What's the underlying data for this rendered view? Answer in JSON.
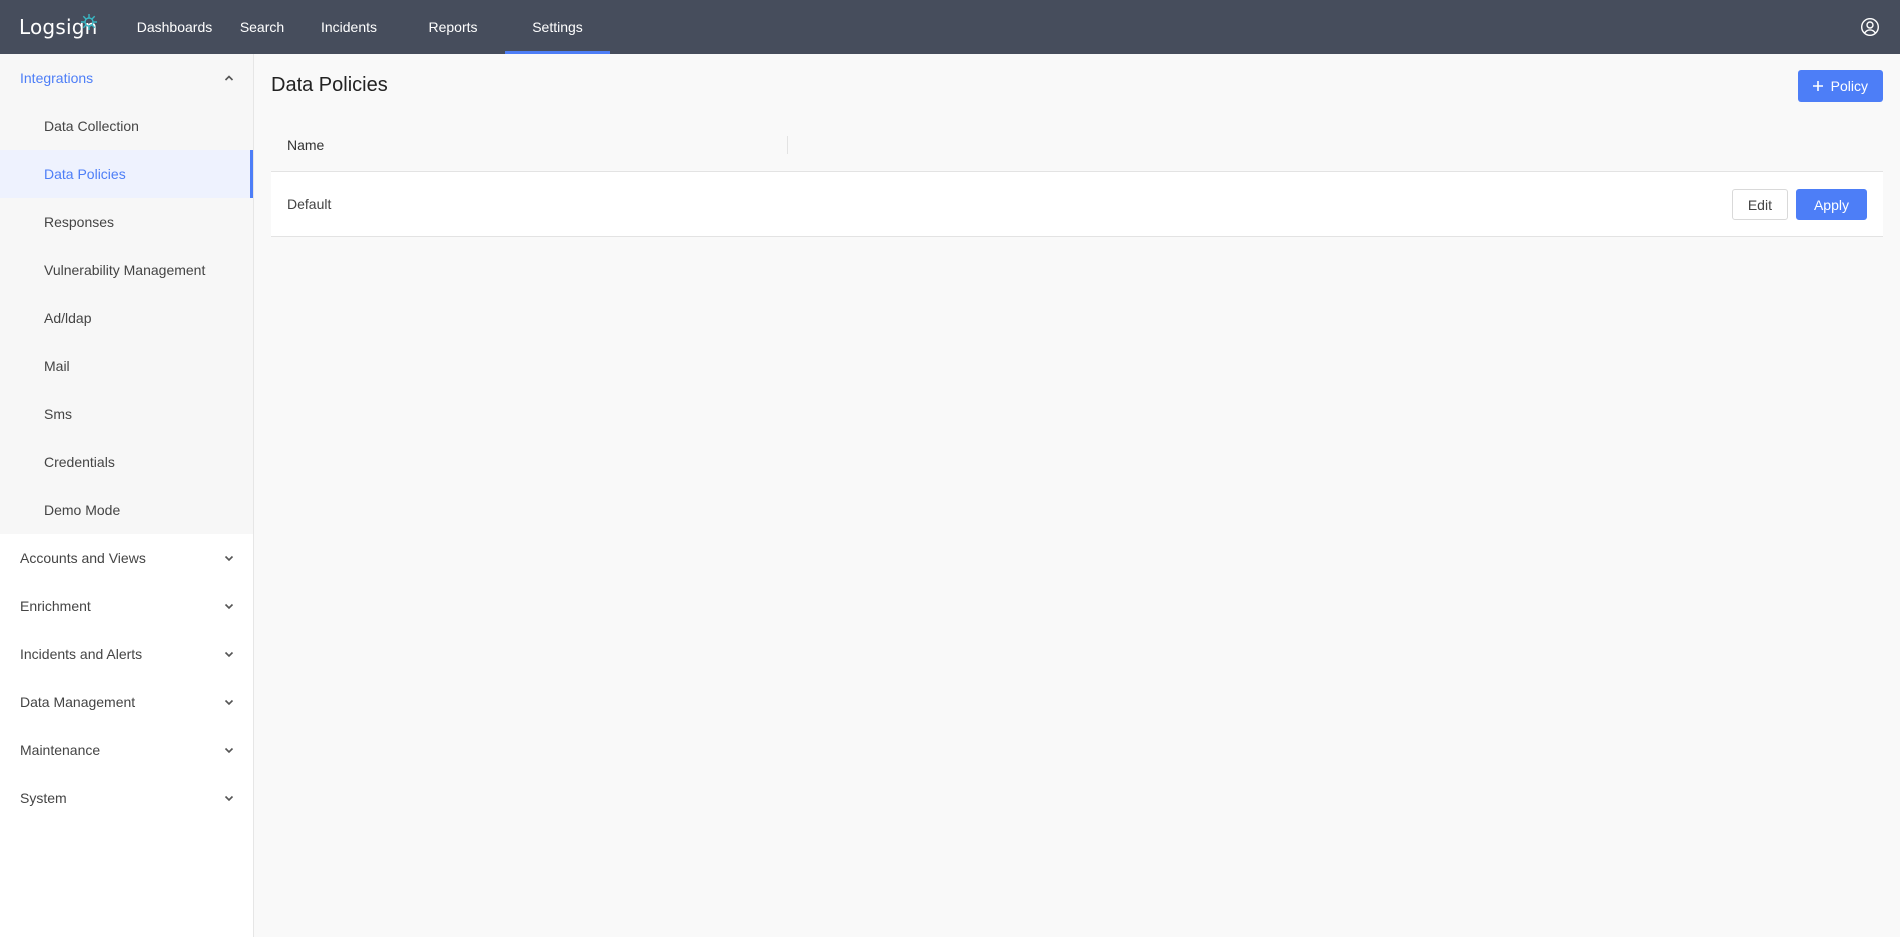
{
  "header": {
    "logo_text": "Logsign",
    "nav": [
      {
        "label": "Dashboards",
        "active": false
      },
      {
        "label": "Search",
        "active": false
      },
      {
        "label": "Incidents",
        "active": false
      },
      {
        "label": "Reports",
        "active": false
      },
      {
        "label": "Settings",
        "active": true
      }
    ],
    "user_icon": "user-circle-icon"
  },
  "sidebar": {
    "groups": [
      {
        "label": "Integrations",
        "expanded": true,
        "items": [
          {
            "label": "Data Collection",
            "active": false
          },
          {
            "label": "Data Policies",
            "active": true
          },
          {
            "label": "Responses",
            "active": false
          },
          {
            "label": "Vulnerability Management",
            "active": false
          },
          {
            "label": "Ad/ldap",
            "active": false
          },
          {
            "label": "Mail",
            "active": false
          },
          {
            "label": "Sms",
            "active": false
          },
          {
            "label": "Credentials",
            "active": false
          },
          {
            "label": "Demo Mode",
            "active": false
          }
        ]
      },
      {
        "label": "Accounts and Views",
        "expanded": false
      },
      {
        "label": "Enrichment",
        "expanded": false
      },
      {
        "label": "Incidents and Alerts",
        "expanded": false
      },
      {
        "label": "Data Management",
        "expanded": false
      },
      {
        "label": "Maintenance",
        "expanded": false
      },
      {
        "label": "System",
        "expanded": false
      }
    ]
  },
  "main": {
    "title": "Data Policies",
    "add_button_label": "Policy",
    "table": {
      "columns": [
        "Name"
      ],
      "rows": [
        {
          "name": "Default",
          "edit_label": "Edit",
          "apply_label": "Apply"
        }
      ]
    }
  },
  "colors": {
    "topbar": "#464d5c",
    "accent": "#4d7ef7",
    "background": "#f9f9f9"
  }
}
